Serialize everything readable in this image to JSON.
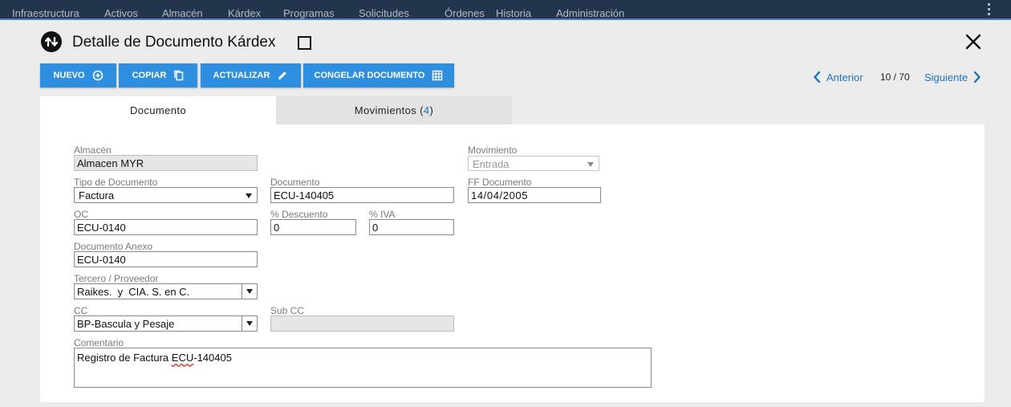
{
  "topnav": {
    "items": [
      "Infraestructura",
      "Activos",
      "Almacén",
      "Kárdex",
      "Programas",
      "Solicitudes",
      "Órdenes",
      "Historia",
      "Administración"
    ]
  },
  "header": {
    "title": "Detalle de Documento Kárdex",
    "icon": "exchange-arrows-icon",
    "close_icon": "close-icon"
  },
  "toolbar": {
    "nuevo": "NUEVO",
    "copiar": "COPIAR",
    "actualizar": "ACTUALIZAR",
    "congelar": "CONGELAR DOCUMENTO"
  },
  "pager": {
    "prev": "Anterior",
    "count": "10 / 70",
    "next": "Siguiente"
  },
  "tabs": {
    "documento": "Documento",
    "movimientos_label": "Movimientos",
    "movimientos_open": "(",
    "movimientos_count": "4",
    "movimientos_close": ")"
  },
  "form": {
    "almacen": {
      "label": "Almacén",
      "value": "Almacen MYR"
    },
    "movimiento": {
      "label": "Movimiento",
      "value": "Entrada"
    },
    "tipo_documento": {
      "label": "Tipo de Documento",
      "value": "Factura"
    },
    "documento": {
      "label": "Documento",
      "value": "ECU-140405"
    },
    "ff_documento": {
      "label": "FF Documento",
      "value": "14/04/2005"
    },
    "oc": {
      "label": "OC",
      "value": "ECU-0140"
    },
    "descuento": {
      "label": "% Descuento",
      "value": "0"
    },
    "iva": {
      "label": "% IVA",
      "value": "0"
    },
    "documento_anexo": {
      "label": "Documento Anexo",
      "value": "ECU-0140"
    },
    "tercero": {
      "label": "Tercero / Proveedor",
      "value": "Raikes.  y  CIA. S. en C."
    },
    "cc": {
      "label": "CC",
      "value": "BP-Bascula y Pesaje"
    },
    "sub_cc": {
      "label": "Sub CC",
      "value": ""
    },
    "comentario": {
      "label": "Comentario",
      "value_prefix": "Registro de Factura ",
      "value_flagged": "ECU",
      "value_suffix": "-140405"
    }
  },
  "colors": {
    "nav_bg": "#22354d",
    "button_blue": "#2e8ee0",
    "link_blue": "#1f72bf"
  }
}
